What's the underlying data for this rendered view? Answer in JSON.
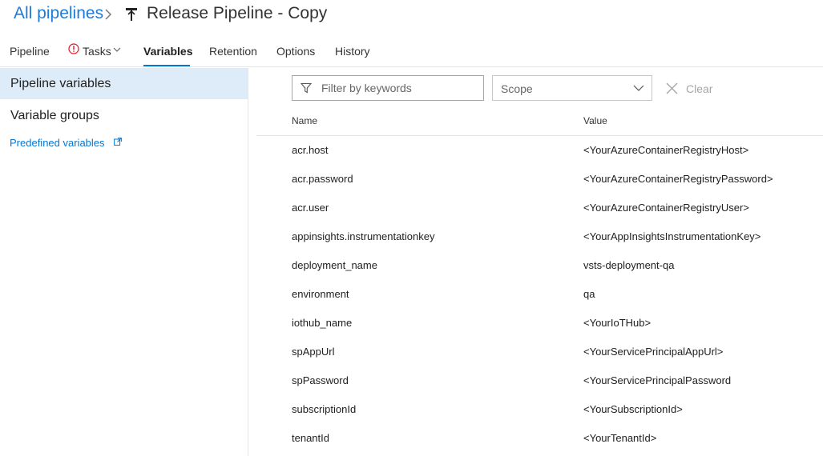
{
  "header": {
    "breadcrumb_link": "All pipelines",
    "title": "Release Pipeline - Copy"
  },
  "tabs": [
    {
      "label": "Pipeline"
    },
    {
      "label": "Tasks"
    },
    {
      "label": "Variables"
    },
    {
      "label": "Retention"
    },
    {
      "label": "Options"
    },
    {
      "label": "History"
    }
  ],
  "active_tab": "Variables",
  "sidebar": {
    "items": [
      {
        "label": "Pipeline variables"
      },
      {
        "label": "Variable groups"
      }
    ],
    "link": "Predefined variables"
  },
  "filter": {
    "placeholder": "Filter by keywords",
    "value": "",
    "scope_label": "Scope",
    "clear_label": "Clear"
  },
  "table": {
    "columns": [
      "Name",
      "Value"
    ],
    "rows": [
      {
        "name": "acr.host",
        "value": "<YourAzureContainerRegistryHost>"
      },
      {
        "name": "acr.password",
        "value": "<YourAzureContainerRegistryPassword>"
      },
      {
        "name": "acr.user",
        "value": "<YourAzureContainerRegistryUser>"
      },
      {
        "name": "appinsights.instrumentationkey",
        "value": "<YourAppInsightsInstrumentationKey>"
      },
      {
        "name": "deployment_name",
        "value": "vsts-deployment-qa"
      },
      {
        "name": "environment",
        "value": "qa"
      },
      {
        "name": "iothub_name",
        "value": "<YourIoTHub>"
      },
      {
        "name": "spAppUrl",
        "value": "<YourServicePrincipalAppUrl>"
      },
      {
        "name": "spPassword",
        "value": "<YourServicePrincipalPassword"
      },
      {
        "name": "subscriptionId",
        "value": "<YourSubscriptionId>"
      },
      {
        "name": "tenantId",
        "value": "<YourTenantId>"
      }
    ]
  },
  "colors": {
    "accent": "#0078d7",
    "link": "#1e7bd7",
    "selected_bg": "#deecf9",
    "warning": "#e81123"
  },
  "icons": {
    "breadcrumb_separator": "chevron-right-icon",
    "pipeline": "release-pipeline-icon",
    "tasks_status": "warning-circle-icon",
    "tasks_menu": "chevron-down-icon",
    "external_link": "external-link-icon",
    "filter": "filter-icon",
    "scope_dropdown": "chevron-down-icon",
    "clear": "close-icon"
  }
}
